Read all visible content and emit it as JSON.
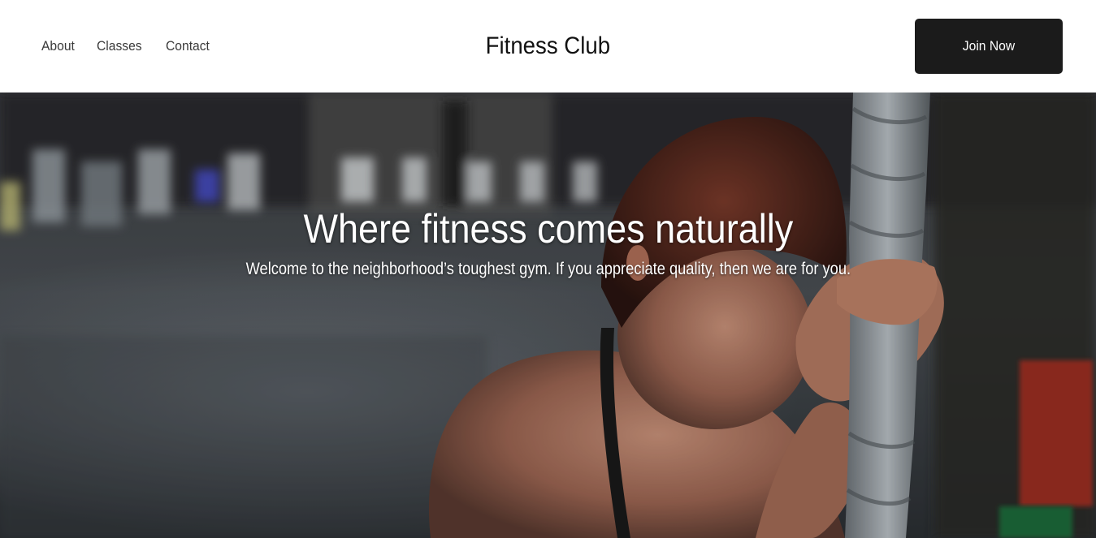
{
  "header": {
    "nav": [
      {
        "label": "About"
      },
      {
        "label": "Classes"
      },
      {
        "label": "Contact"
      }
    ],
    "brand": "Fitness Club",
    "cta_label": "Join Now"
  },
  "hero": {
    "title": "Where fitness comes naturally",
    "subtitle": "Welcome to the neighborhood’s toughest gym. If you appreciate quality, then we are for you."
  },
  "colors": {
    "header_bg": "#ffffff",
    "cta_bg": "#1b1b1b",
    "cta_text": "#ffffff",
    "nav_text": "#3a3a3a",
    "hero_text": "#ffffff"
  }
}
